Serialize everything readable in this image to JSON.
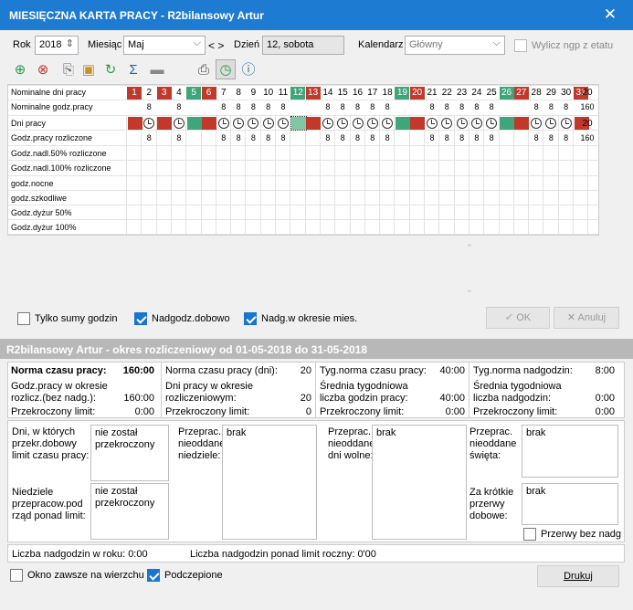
{
  "window": {
    "title": "MIESIĘCZNA KARTA PRACY - R2bilansowy Artur",
    "close": "✕"
  },
  "top": {
    "rok_label": "Rok",
    "rok_value": "2018",
    "miesiac_label": "Miesiąc",
    "miesiac_value": "Maj",
    "nav": "< >",
    "dzien_label": "Dzień",
    "dzien_value": "12, sobota",
    "kalendarz_label": "Kalendarz",
    "kalendarz_value": "Główny",
    "wylicz_label": "Wylicz ngp z etatu"
  },
  "toolbar_icons": [
    "add-day-icon",
    "delete-day-icon",
    "copy-icon",
    "paste-icon",
    "refresh-icon",
    "sum-icon",
    "page-icon",
    "print-icon",
    "clock-fill-icon",
    "info-icon"
  ],
  "grid": {
    "row_labels": [
      "Nominalne dni pracy",
      "Nominalne godz.pracy",
      "Dni pracy",
      "Godz.pracy rozliczone",
      "Godz.nadl.50% rozliczone",
      "Godz.nadl.100% rozliczone",
      "godz.nocne",
      "godz.szkodliwe",
      "Godz.dyżur 50%",
      "Godz.dyżur 100%"
    ],
    "days": [
      "1",
      "2",
      "3",
      "4",
      "5",
      "6",
      "7",
      "8",
      "9",
      "10",
      "11",
      "12",
      "13",
      "14",
      "15",
      "16",
      "17",
      "18",
      "19",
      "20",
      "21",
      "22",
      "23",
      "24",
      "25",
      "26",
      "27",
      "28",
      "29",
      "30",
      "31"
    ],
    "day_colors": [
      "red",
      "",
      "red",
      "",
      "grn",
      "red",
      "",
      "",
      "",
      "",
      "",
      "grn",
      "red",
      "",
      "",
      "",
      "",
      "",
      "grn",
      "red",
      "",
      "",
      "",
      "",
      "",
      "grn",
      "red",
      "",
      "",
      "",
      "red"
    ],
    "nominal_hours": [
      "",
      "8",
      "",
      "8",
      "",
      "",
      "8",
      "8",
      "8",
      "8",
      "8",
      "",
      "",
      "8",
      "8",
      "8",
      "8",
      "8",
      "",
      "",
      "8",
      "8",
      "8",
      "8",
      "8",
      "",
      "",
      "8",
      "8",
      "8",
      ""
    ],
    "work_marks": [
      "red",
      "clk",
      "red",
      "clk",
      "grn",
      "red",
      "clk",
      "clk",
      "clk",
      "clk",
      "clk",
      "grnsel",
      "red",
      "clk",
      "clk",
      "clk",
      "clk",
      "clk",
      "grn",
      "red",
      "clk",
      "clk",
      "clk",
      "clk",
      "clk",
      "grn",
      "red",
      "clk",
      "clk",
      "clk",
      "red"
    ],
    "worked_hours": [
      "",
      "8",
      "",
      "8",
      "",
      "",
      "8",
      "8",
      "8",
      "8",
      "8",
      "",
      "",
      "8",
      "8",
      "8",
      "8",
      "8",
      "",
      "",
      "8",
      "8",
      "8",
      "8",
      "8",
      "",
      "",
      "8",
      "8",
      "8",
      ""
    ],
    "totals": {
      "nominal_days": "20",
      "nominal_hours": "160",
      "work_days": "20",
      "work_hours": "160"
    }
  },
  "options": {
    "tylko_sumy": "Tylko sumy godzin",
    "nadgodz_dobowo": "Nadgodz.dobowo",
    "nadg_okresie": "Nadg.w okresie mies.",
    "ok": "OK",
    "anuluj": "Anuluj"
  },
  "period": {
    "header": "R2bilansowy Artur - okres rozliczeniowy od 01-05-2018 do 31-05-2018",
    "col1": [
      [
        "Norma czasu pracy:",
        "160:00"
      ],
      [
        "Godz.pracy w okresie rozlicz.(bez nadg.):",
        "160:00"
      ],
      [
        "Przekroczony limit:",
        "0:00"
      ]
    ],
    "col2": [
      [
        "Norma czasu pracy (dni):",
        "20"
      ],
      [
        "Dni pracy w okresie rozliczeniowym:",
        "20"
      ],
      [
        "Przekroczony limit:",
        "0"
      ]
    ],
    "col3": [
      [
        "Tyg.norma czasu pracy:",
        "40:00"
      ],
      [
        "Średnia tygodniowa liczba godzin pracy:",
        "40:00"
      ],
      [
        "Przekroczony limit:",
        "0:00"
      ]
    ],
    "col4": [
      [
        "Tyg.norma nadgodzin:",
        "8:00"
      ],
      [
        "Średnia tygodniowa liczba nadgodzin:",
        "0:00"
      ],
      [
        "Przekroczony limit:",
        "0:00"
      ]
    ]
  },
  "limits": {
    "dni_label": "Dni, w których przekr.dobowy limit czasu pracy:",
    "dni_value": "nie został przekroczony",
    "niedziele_label": "Niedziele przepracow.pod rząd ponad limit:",
    "niedziele_value": "nie został przekroczony",
    "nieoddane_niedziele_label": "Przeprac. nieoddane niedziele:",
    "nieoddane_niedziele_value": "brak",
    "nieoddane_wolne_label": "Przeprac. nieoddane dni wolne:",
    "nieoddane_wolne_value": "brak",
    "nieoddane_swieta_label": "Przeprac. nieoddane święta:",
    "nieoddane_swieta_value": "brak",
    "przerwy_label": "Za krótkie przerwy dobowe:",
    "przerwy_value": "brak",
    "przerwy_bez_nadg": "Przerwy bez nadg",
    "nadg_rok": "Liczba nadgodzin w roku: 0:00",
    "nadg_limit": "Liczba nadgodzin ponad limit roczny: 0'00"
  },
  "bottom": {
    "okno": "Okno zawsze na wierzchu",
    "podczepione": "Podczepione",
    "drukuj": "Drukuj"
  }
}
